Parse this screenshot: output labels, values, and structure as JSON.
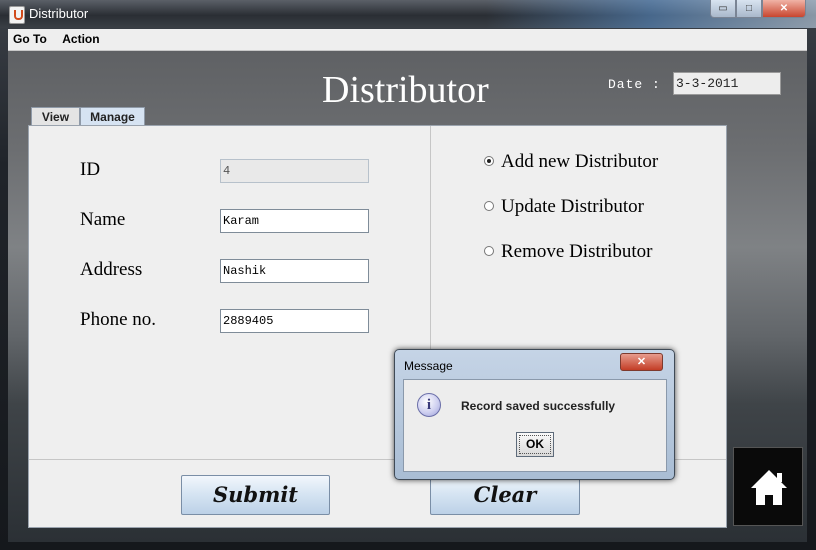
{
  "window": {
    "title": "Distributor",
    "controls": {
      "minimize": "▭",
      "maximize": "□",
      "close": "✕"
    }
  },
  "menubar": [
    "Go To",
    "Action"
  ],
  "header": {
    "title": "Distributor",
    "date_label": "Date :",
    "date_value": "3-3-2011"
  },
  "tabs": [
    {
      "label": "View",
      "selected": false
    },
    {
      "label": "Manage",
      "selected": true
    }
  ],
  "form": {
    "fields": [
      {
        "label": "ID",
        "value": "4",
        "editable": false
      },
      {
        "label": "Name",
        "value": "Karam",
        "editable": true
      },
      {
        "label": "Address",
        "value": "Nashik",
        "editable": true
      },
      {
        "label": "Phone no.",
        "value": "2889405",
        "editable": true
      }
    ],
    "options": [
      {
        "label": "Add new Distributor",
        "checked": true
      },
      {
        "label": "Update Distributor",
        "checked": false
      },
      {
        "label": "Remove Distributor",
        "checked": false
      }
    ],
    "submit_label": "Submit",
    "clear_label": "Clear"
  },
  "home": {
    "icon": "home-icon"
  },
  "dialog": {
    "title": "Message",
    "icon": "info-icon",
    "icon_glyph": "i",
    "close": "✕",
    "message": "Record saved successfully",
    "ok_label": "OK"
  }
}
